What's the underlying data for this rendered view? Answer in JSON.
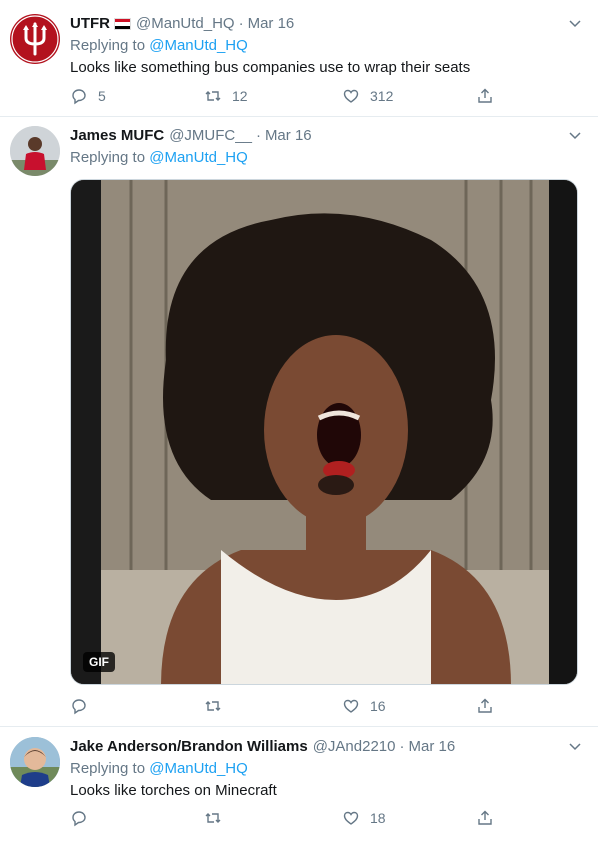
{
  "tweets": [
    {
      "name": "UTFR",
      "handle": "@ManUtd_HQ",
      "date": "Mar 16",
      "replying_prefix": "Replying to",
      "replying_to": "@ManUtd_HQ",
      "text": "Looks like something bus companies use to wrap their seats",
      "replies": "5",
      "retweets": "12",
      "likes": "312"
    },
    {
      "name": "James MUFC",
      "handle": "@JMUFC__",
      "date": "Mar 16",
      "replying_prefix": "Replying to",
      "replying_to": "@ManUtd_HQ",
      "media_badge": "GIF",
      "replies": "",
      "retweets": "",
      "likes": "16"
    },
    {
      "name": "Jake Anderson/Brandon Williams",
      "handle": "@JAnd2210",
      "date": "Mar 16",
      "replying_prefix": "Replying to",
      "replying_to": "@ManUtd_HQ",
      "text": "Looks like torches on Minecraft",
      "replies": "",
      "retweets": "",
      "likes": "18"
    }
  ],
  "icons": {
    "reply": "reply-icon",
    "retweet": "retweet-icon",
    "like": "heart-icon",
    "share": "share-icon",
    "menu": "chevron-down-icon"
  },
  "colors": {
    "link": "#1da1f2",
    "muted": "#657786",
    "border": "#e6ecf0",
    "utfr_red": "#b3121e"
  }
}
